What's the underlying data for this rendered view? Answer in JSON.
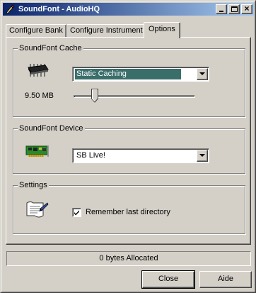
{
  "window": {
    "title": "SoundFont - AudioHQ"
  },
  "tabs": [
    {
      "label": "Configure Bank"
    },
    {
      "label": "Configure Instrument"
    },
    {
      "label": "Options",
      "active": true
    }
  ],
  "cache": {
    "group_label": "SoundFont Cache",
    "mode_value": "Static Caching",
    "size_label": "9.50 MB",
    "icon": "memory-chip-icon"
  },
  "device": {
    "group_label": "SoundFont Device",
    "value": "SB Live!",
    "icon": "sound-card-icon"
  },
  "settings": {
    "group_label": "Settings",
    "remember_label": "Remember last directory",
    "remember_checked": true,
    "icon": "document-pen-icon"
  },
  "status": {
    "text": "0 bytes Allocated"
  },
  "buttons": {
    "close": "Close",
    "help": "Aide"
  },
  "colors": {
    "title_start": "#0a246a",
    "title_end": "#a6caf0",
    "face": "#d4d0c8",
    "selection": "#3a6e6a"
  }
}
